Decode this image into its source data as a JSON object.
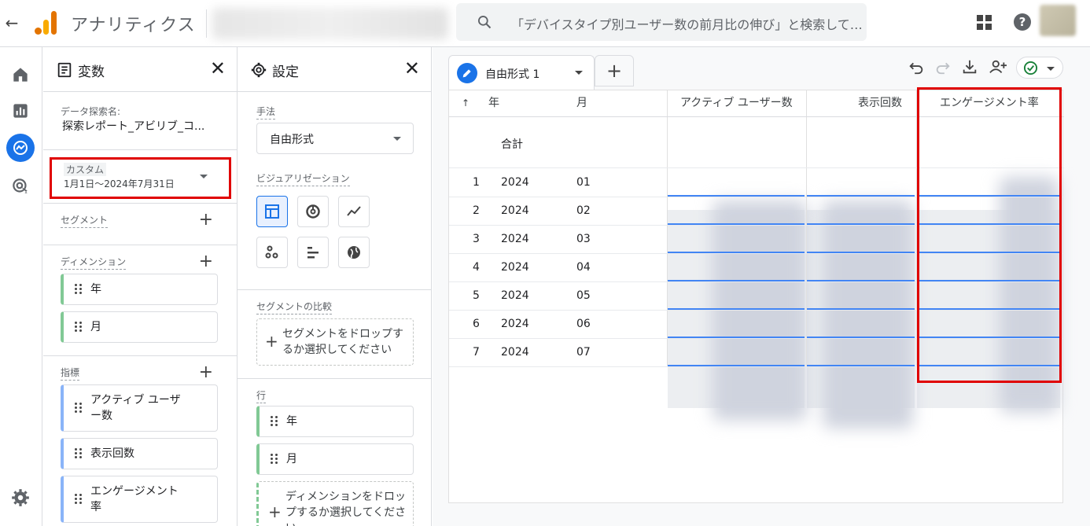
{
  "topbar": {
    "back_icon": "arrow-back-icon",
    "app_title": "アナリティクス",
    "search_placeholder": "「デバイスタイプ別ユーザー数の前月比の伸び」と検索して…"
  },
  "variables": {
    "title": "変数",
    "exploration_label": "データ探索名:",
    "exploration_name": "探索レポート_アビリブ_コ...",
    "date_custom": "カスタム",
    "date_range": "1月1日～2024年7月31日",
    "segments_label": "セグメント",
    "dimensions_label": "ディメンション",
    "dimensions": [
      "年",
      "月"
    ],
    "metrics_label": "指標",
    "metrics": [
      "アクティブ ユーザ\nー数",
      "表示回数",
      "エンゲージメント\n率"
    ]
  },
  "settings": {
    "title": "設定",
    "technique_label": "手法",
    "technique_value": "自由形式",
    "viz_label": "ビジュアリゼーション",
    "segment_compare_label": "セグメントの比較",
    "segment_drop_text": "セグメントをドロップするか選択してください",
    "rows_label": "行",
    "rows": [
      "年",
      "月"
    ],
    "dimension_drop_text": "ディメンションをドロップするか選択してください"
  },
  "main": {
    "tab_label": "自由形式 1",
    "columns": {
      "sort": "↑",
      "year": "年",
      "month": "月",
      "active_users": "アクティブ ユーザー数",
      "views": "表示回数",
      "engagement": "エンゲージメント率"
    },
    "total_label": "合計",
    "rows": [
      {
        "n": "1",
        "year": "2024",
        "month": "01"
      },
      {
        "n": "2",
        "year": "2024",
        "month": "02"
      },
      {
        "n": "3",
        "year": "2024",
        "month": "03"
      },
      {
        "n": "4",
        "year": "2024",
        "month": "04"
      },
      {
        "n": "5",
        "year": "2024",
        "month": "05"
      },
      {
        "n": "6",
        "year": "2024",
        "month": "06"
      },
      {
        "n": "7",
        "year": "2024",
        "month": "07"
      }
    ]
  },
  "colors": {
    "accent": "#1a73e8",
    "highlight_box": "#e00000",
    "dimension_chip": "#81c995",
    "metric_chip": "#8ab4f8"
  }
}
